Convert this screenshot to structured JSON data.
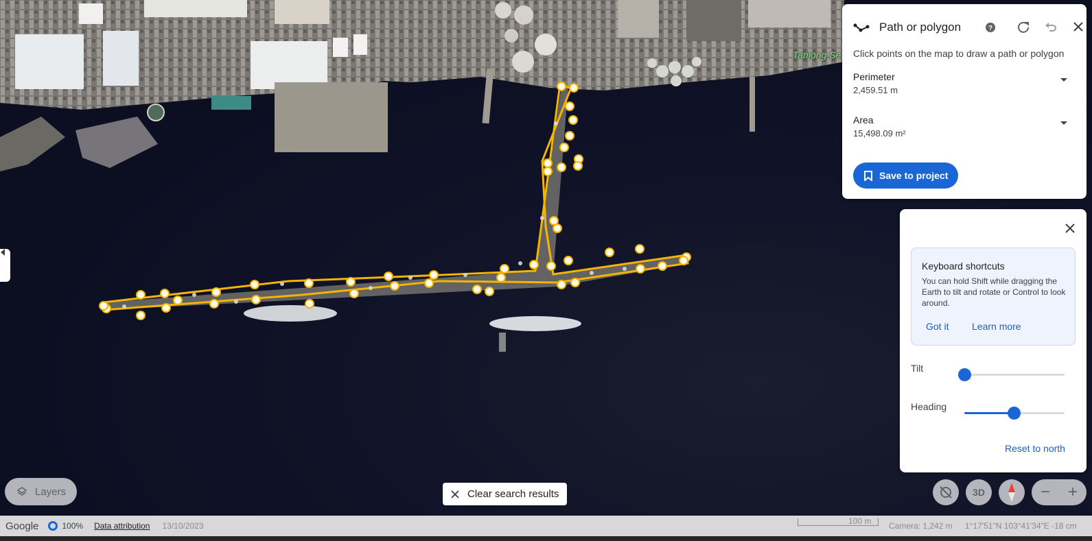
{
  "map": {
    "place_label": "Tanjong Se"
  },
  "measure_panel": {
    "title": "Path or polygon",
    "hint": "Click points on the map to draw a path or polygon",
    "perimeter": {
      "label": "Perimeter",
      "value": "2,459.51 m"
    },
    "area": {
      "label": "Area",
      "value": "15,498.09 m²"
    },
    "save_label": "Save to project",
    "icons": [
      "path-icon",
      "help-icon",
      "redo-icon",
      "undo-icon",
      "close-icon",
      "bookmark-icon",
      "chevron-down-icon"
    ]
  },
  "nav_panel": {
    "shortcuts": {
      "title": "Keyboard shortcuts",
      "body": "You can hold Shift while dragging the Earth to tilt and rotate or Control to look around.",
      "got_it": "Got it",
      "learn_more": "Learn more"
    },
    "tilt": {
      "label": "Tilt",
      "level": 0.0
    },
    "heading": {
      "label": "Heading",
      "level": 0.49
    },
    "reset_label": "Reset to north"
  },
  "controls": {
    "layers_label": "Layers",
    "clear_label": "Clear search results",
    "three_d_label": "3D",
    "zoom_out": "−",
    "zoom_in": "+"
  },
  "statusbar": {
    "brand": "Google",
    "loading_pct": "100%",
    "attribution": "Data attribution",
    "date": "13/10/2023",
    "scale": "100 m",
    "camera": "Camera: 1,242 m",
    "coords": "1°17'51\"N 103°41'34\"E  -18 cm"
  },
  "colors": {
    "accent": "#1a66d6",
    "path": "#f4b400",
    "water": "#0d1024"
  }
}
